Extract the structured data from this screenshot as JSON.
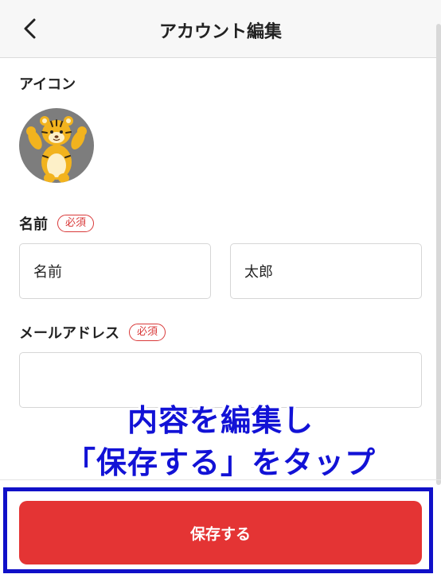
{
  "header": {
    "title": "アカウント編集"
  },
  "icon_section": {
    "label": "アイコン"
  },
  "name_section": {
    "label": "名前",
    "required_badge": "必須",
    "last_name_value": "名前",
    "first_name_value": "太郎"
  },
  "email_section": {
    "label": "メールアドレス",
    "required_badge": "必須",
    "value": ""
  },
  "annotation": {
    "line1": "内容を編集し",
    "line2": "「保存する」をタップ"
  },
  "footer": {
    "save_label": "保存する"
  },
  "colors": {
    "accent_red": "#e43434",
    "badge_red": "#d93a3a",
    "annotation_blue": "#1212d6"
  }
}
